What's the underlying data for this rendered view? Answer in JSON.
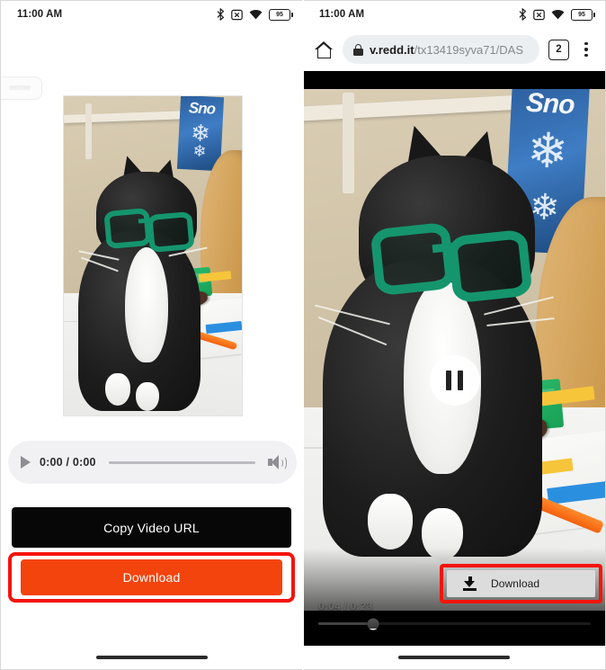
{
  "meta": {
    "description": "Two mobile phone screenshots side by side showing a Reddit video download flow"
  },
  "left_panel": {
    "status_bar": {
      "time": "11:00 AM",
      "icons": [
        "bluetooth-icon",
        "sim-x-icon",
        "wifi-icon",
        "battery-icon"
      ],
      "battery_level": "95"
    },
    "media_controls": {
      "play_icon": "play-icon",
      "time_display": "0:00 / 0:00",
      "volume_icon": "volume-icon"
    },
    "buttons": {
      "copy_url_label": "Copy Video URL",
      "download_label": "Download"
    },
    "colors": {
      "download_button": "#f4440d",
      "copy_button": "#070707",
      "highlight_outline": "#f5140a",
      "mediabar_bg": "#f1f1f4"
    }
  },
  "right_panel": {
    "status_bar": {
      "time": "11:00 AM",
      "icons": [
        "bluetooth-icon",
        "sim-x-icon",
        "wifi-icon",
        "battery-icon"
      ],
      "battery_level": "95"
    },
    "browser": {
      "home_icon": "home-icon",
      "lock_icon": "lock-icon",
      "url_host": "v.redd.it",
      "url_path": "/tx13419syva71/DAS",
      "tab_count": "2",
      "menu_icon": "more-vertical-icon"
    },
    "video": {
      "state_icon": "pause-icon",
      "time_display": "0:04 / 0:23",
      "progress_percent": 20,
      "download_icon": "download-icon",
      "download_label": "Download"
    },
    "colors": {
      "highlight_outline": "#f5140a",
      "download_button": "#dcdcdc",
      "letterbox": "#000000"
    }
  },
  "video_scene": {
    "subject": "black and white cat wearing green glasses",
    "objects": [
      "wall-shelf",
      "snowflake-box",
      "acoustic-guitar",
      "green-container",
      "brown-sunglasses",
      "orange-pen",
      "white-desk"
    ]
  }
}
